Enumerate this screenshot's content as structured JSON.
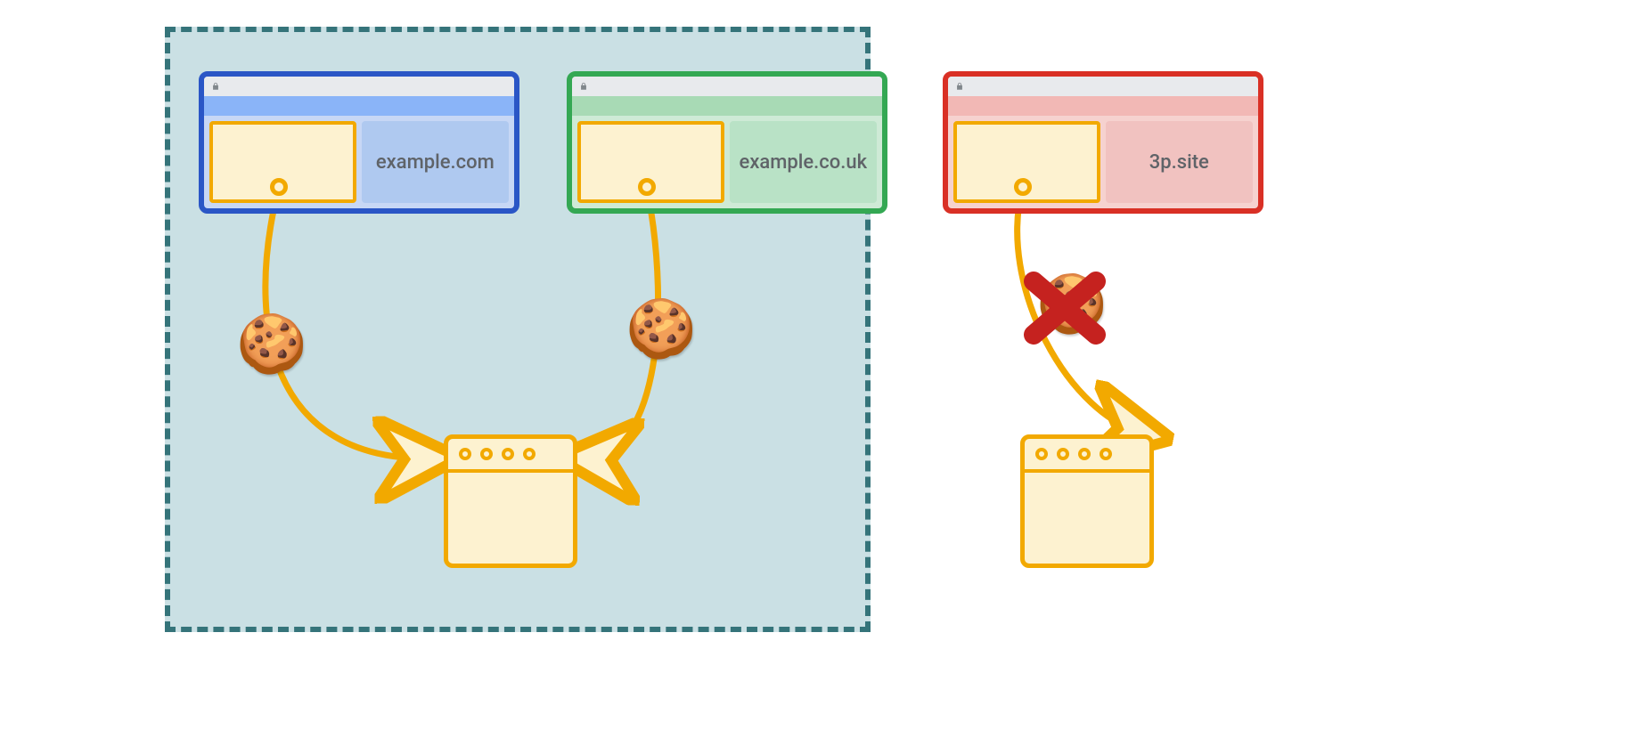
{
  "colors": {
    "group_border": "#35747a",
    "group_fill": "#cae0e4",
    "arrow": "#f2a900",
    "blue": "#2a56c6",
    "green": "#34a853",
    "red": "#d93025",
    "embed_border": "#f2a900",
    "embed_fill": "#fdf2d0",
    "blocked_x": "#c5221f"
  },
  "icons": {
    "cookie_glyph": "🍪",
    "lock_glyph": "lock-icon"
  },
  "browsers": {
    "first_party_a": {
      "domain_label": "example.com",
      "theme": "blue",
      "cookie_allowed": true
    },
    "first_party_b": {
      "domain_label": "example.co.uk",
      "theme": "green",
      "cookie_allowed": true
    },
    "third_party": {
      "domain_label": "3p.site",
      "theme": "red",
      "cookie_allowed": false
    }
  },
  "servers": {
    "shared_first_party": {
      "dots": 4
    },
    "third_party": {
      "dots": 4
    }
  },
  "group": {
    "description": "first-party-set",
    "members": [
      "first_party_a",
      "first_party_b"
    ]
  }
}
